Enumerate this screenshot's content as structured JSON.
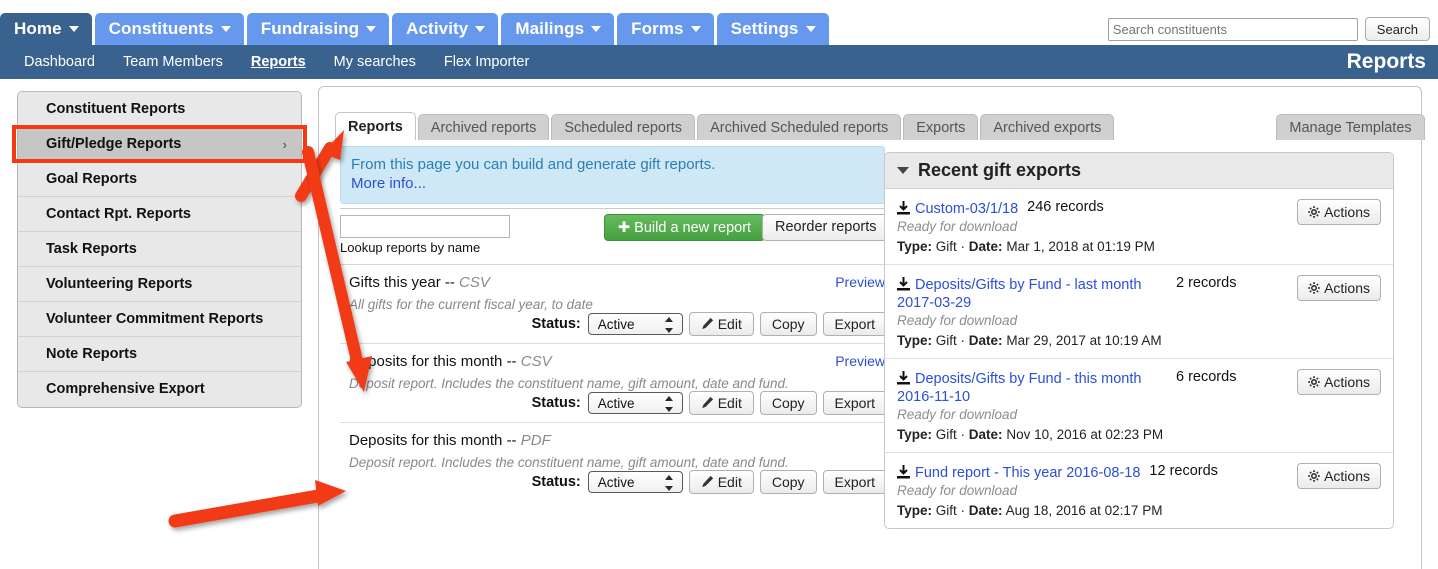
{
  "topnav": {
    "tabs": [
      {
        "label": "Home",
        "active": true,
        "caret": true
      },
      {
        "label": "Constituents",
        "active": false,
        "caret": true
      },
      {
        "label": "Fundraising",
        "active": false,
        "caret": true
      },
      {
        "label": "Activity",
        "active": false,
        "caret": true
      },
      {
        "label": "Mailings",
        "active": false,
        "caret": true
      },
      {
        "label": "Forms",
        "active": false,
        "caret": true
      },
      {
        "label": "Settings",
        "active": false,
        "caret": true
      }
    ],
    "search": {
      "placeholder": "Search constituents",
      "value": "",
      "button_label": "Search"
    },
    "accent_active": "#39628f",
    "accent_tab": "#6699ee"
  },
  "subnav": {
    "items": [
      {
        "label": "Dashboard",
        "current": false
      },
      {
        "label": "Team Members",
        "current": false
      },
      {
        "label": "Reports",
        "current": true
      },
      {
        "label": "My searches",
        "current": false
      },
      {
        "label": "Flex Importer",
        "current": false
      }
    ],
    "page_title": "Reports"
  },
  "sidebar": {
    "items": [
      {
        "label": "Constituent Reports",
        "selected": false,
        "chevron": ""
      },
      {
        "label": "Gift/Pledge Reports",
        "selected": true,
        "chevron": "›"
      },
      {
        "label": "Goal Reports",
        "selected": false,
        "chevron": ""
      },
      {
        "label": "Contact Rpt. Reports",
        "selected": false,
        "chevron": ""
      },
      {
        "label": "Task Reports",
        "selected": false,
        "chevron": ""
      },
      {
        "label": "Volunteering Reports",
        "selected": false,
        "chevron": ""
      },
      {
        "label": "Volunteer Commitment Reports",
        "selected": false,
        "chevron": ""
      },
      {
        "label": "Note Reports",
        "selected": false,
        "chevron": ""
      },
      {
        "label": "Comprehensive Export",
        "selected": false,
        "chevron": ""
      }
    ],
    "highlight_color": "#f23b12"
  },
  "tabs": [
    {
      "label": "Reports",
      "active": true
    },
    {
      "label": "Archived reports",
      "active": false
    },
    {
      "label": "Scheduled reports",
      "active": false
    },
    {
      "label": "Archived Scheduled reports",
      "active": false
    },
    {
      "label": "Exports",
      "active": false
    },
    {
      "label": "Archived exports",
      "active": false
    }
  ],
  "manage_templates_tab": {
    "label": "Manage Templates"
  },
  "info_banner": {
    "text": "From this page you can build and generate gift reports.",
    "more_link": "More info..."
  },
  "toolbar": {
    "lookup_placeholder": "",
    "lookup_value": "",
    "lookup_label": "Lookup reports by name",
    "build_label": "✚ Build a new report",
    "reorder_label": "Reorder reports"
  },
  "reports": [
    {
      "name": "Gifts this year --",
      "format": "CSV",
      "description": "All gifts for the current fiscal year, to date",
      "preview_label": "Preview",
      "has_preview": true,
      "status_label": "Status:",
      "status_value": "Active",
      "edit_label": "Edit",
      "copy_label": "Copy",
      "export_label": "Export"
    },
    {
      "name": "Deposits for this month --",
      "format": "CSV",
      "description": "Deposit report. Includes the constituent name, gift amount, date and fund.",
      "preview_label": "Preview",
      "has_preview": true,
      "status_label": "Status:",
      "status_value": "Active",
      "edit_label": "Edit",
      "copy_label": "Copy",
      "export_label": "Export"
    },
    {
      "name": "Deposits for this month --",
      "format": "PDF",
      "description": "Deposit report. Includes the constituent name, gift amount, date and fund.",
      "preview_label": "",
      "has_preview": false,
      "status_label": "Status:",
      "status_value": "Active",
      "edit_label": "Edit",
      "copy_label": "Copy",
      "export_label": "Export"
    }
  ],
  "recent_exports": {
    "title": "Recent gift exports",
    "actions_label": "Actions",
    "items": [
      {
        "name": "Custom-03/1/18",
        "records": "246 records",
        "status": "Ready for download",
        "type_label": "Type:",
        "type_value": "Gift",
        "date_label": "Date:",
        "date_value": "Mar 1, 2018 at 01:19 PM"
      },
      {
        "name": "Deposits/Gifts by Fund - last month 2017-03-29",
        "records": "2 records",
        "status": "Ready for download",
        "type_label": "Type:",
        "type_value": "Gift",
        "date_label": "Date:",
        "date_value": "Mar 29, 2017 at 10:19 AM"
      },
      {
        "name": "Deposits/Gifts by Fund - this month 2016-11-10",
        "records": "6 records",
        "status": "Ready for download",
        "type_label": "Type:",
        "type_value": "Gift",
        "date_label": "Date:",
        "date_value": "Nov 10, 2016 at 02:23 PM"
      },
      {
        "name": "Fund report - This year 2016-08-18",
        "records": "12 records",
        "status": "Ready for download",
        "type_label": "Type:",
        "type_value": "Gift",
        "date_label": "Date:",
        "date_value": "Aug 18, 2016 at 02:17 PM"
      }
    ]
  },
  "annotations": {
    "color": "#f23b12",
    "arrow_to_reports_tab": "arrow-pointing-to-reports-tab",
    "arrow_to_deposits_csv": "arrow-pointing-to-deposits-csv-row",
    "arrow_to_deposits_pdf": "arrow-pointing-to-deposits-pdf-row"
  }
}
